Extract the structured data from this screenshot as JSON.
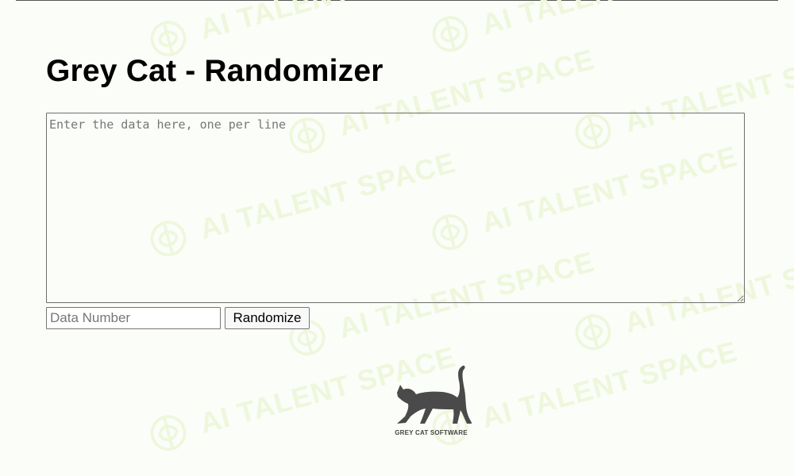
{
  "page": {
    "title": "Grey Cat - Randomizer"
  },
  "form": {
    "data_placeholder": "Enter the data here, one per line",
    "data_value": "",
    "number_placeholder": "Data Number",
    "number_value": "",
    "randomize_label": "Randomize"
  },
  "brand": {
    "name": "GREY CAT SOFTWARE",
    "logo_icon": "cat-icon"
  },
  "watermark": {
    "text": "AI TALENT SPACE",
    "icon": "brain-icon"
  },
  "colors": {
    "background": "#fbfdf8",
    "watermark": "#eef7dc",
    "cat": "#4a4a4a"
  }
}
